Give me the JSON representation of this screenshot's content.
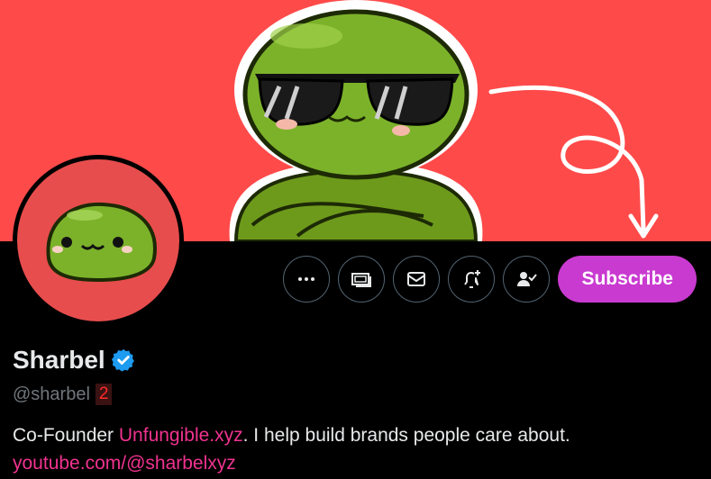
{
  "profile": {
    "name": "Sharbel",
    "handle": "@sharbel",
    "badge_count": "2",
    "bio_prefix": "Co-Founder ",
    "bio_link": "Unfungible.xyz",
    "bio_suffix": ". I help build brands people care about.",
    "website": "youtube.com/@sharbelxyz"
  },
  "actions": {
    "more_icon": "more-icon",
    "tip_icon": "money-icon",
    "message_icon": "mail-icon",
    "notify_icon": "bell-plus-icon",
    "following_icon": "person-check-icon",
    "subscribe_label": "Subscribe"
  },
  "colors": {
    "banner_bg": "#ff4a4a",
    "subscribe_bg": "#c93ad0",
    "link": "#f0338f",
    "verified": "#1d9bf0",
    "badge": "#ff2b2b"
  }
}
